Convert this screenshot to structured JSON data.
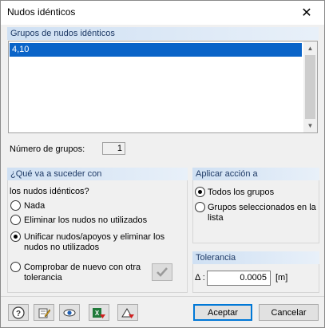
{
  "window": {
    "title": "Nudos idénticos",
    "close_glyph": "✕"
  },
  "groups": {
    "header": "Grupos de nudos idénticos",
    "items": [
      "4,10"
    ],
    "count_label": "Número de grupos:",
    "count_value": "1"
  },
  "what_happens": {
    "header": "¿Qué va a suceder con",
    "subheader": "los nudos idénticos?",
    "options": [
      {
        "label": "Nada",
        "checked": false
      },
      {
        "label": "Eliminar los nudos no utilizados",
        "checked": false
      },
      {
        "label": "Unificar nudos/apoyos y eliminar los nudos no utilizados",
        "checked": true
      },
      {
        "label": "Comprobar de nuevo con otra tolerancia",
        "checked": false
      }
    ]
  },
  "apply_to": {
    "header": "Aplicar acción a",
    "options": [
      {
        "label": "Todos los grupos",
        "checked": true
      },
      {
        "label": "Grupos seleccionados en la lista",
        "checked": false
      }
    ]
  },
  "tolerance": {
    "header": "Tolerancia",
    "symbol": "Δ :",
    "value": "0.0005",
    "unit": "[m]"
  },
  "footer": {
    "icons": [
      "help-icon",
      "edit-icon",
      "view-icon",
      "excel-export-icon",
      "units-icon"
    ],
    "ok_label": "Aceptar",
    "cancel_label": "Cancelar"
  },
  "colors": {
    "selection": "#0a64c8",
    "header_bg": "#cfe0f3",
    "header_text": "#1e3a66"
  }
}
